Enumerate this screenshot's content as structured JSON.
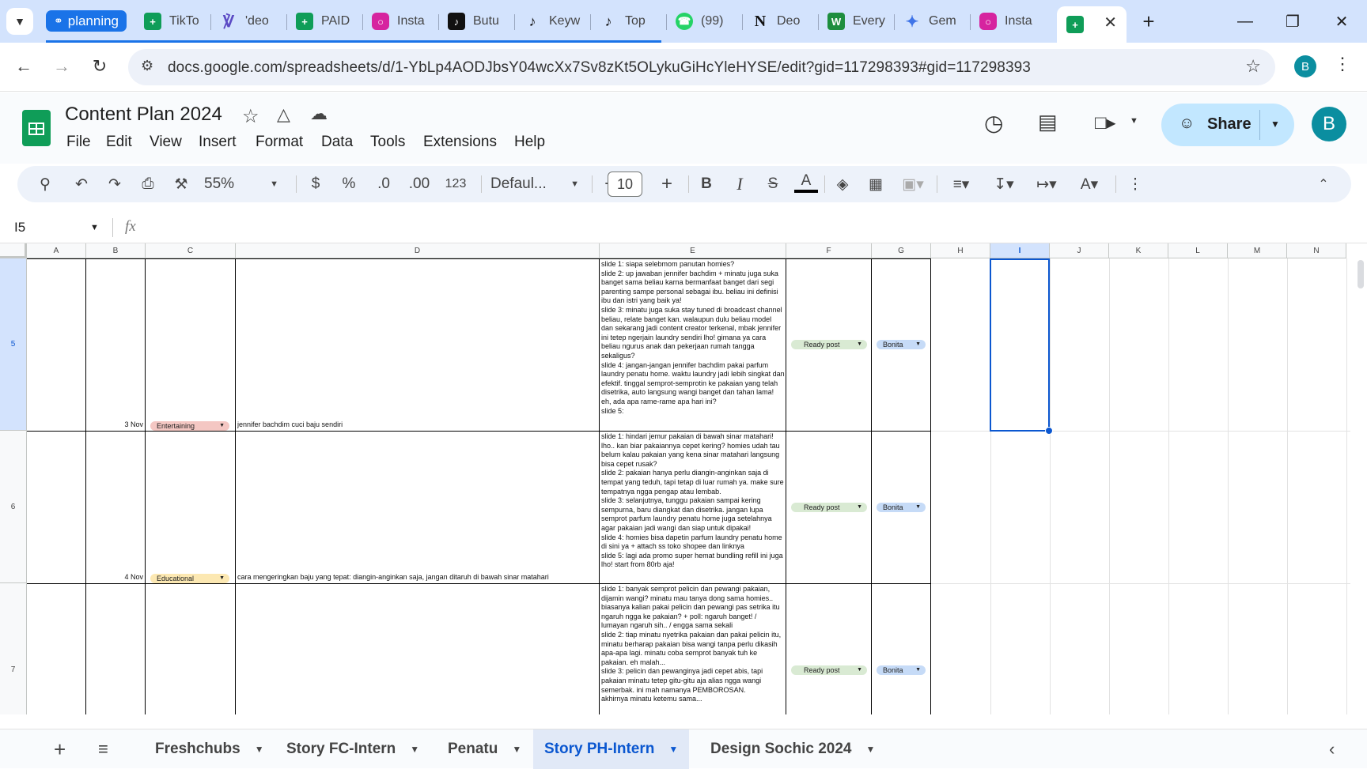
{
  "browser": {
    "profile_tab": "planning",
    "tabs": [
      {
        "label": "TikTo",
        "icon": "sheets-icon"
      },
      {
        "label": "'deo",
        "icon": "canva-icon"
      },
      {
        "label": "PAID",
        "icon": "sheets-icon"
      },
      {
        "label": "Insta",
        "icon": "instagram-icon"
      },
      {
        "label": "Butu",
        "icon": "tiktok-icon"
      },
      {
        "label": "Keyw",
        "icon": "tiktok-icon"
      },
      {
        "label": "Top",
        "icon": "tiktok-icon"
      },
      {
        "label": "(99)",
        "icon": "whatsapp-icon"
      },
      {
        "label": "Deo",
        "icon": "notion-icon"
      },
      {
        "label": "Every",
        "icon": "wix-icon"
      },
      {
        "label": "Gem",
        "icon": "gemini-icon"
      },
      {
        "label": "Insta",
        "icon": "instagram-icon"
      },
      {
        "label": "",
        "icon": "sheets-icon"
      }
    ],
    "url": "docs.google.com/spreadsheets/d/1-YbLp4AODJbsY04wcXx7Sv8zKt5OLykuGiHcYleHYSE/edit?gid=117298393#gid=117298393",
    "avatar_letter": "B"
  },
  "sheets": {
    "title": "Content Plan 2024",
    "menu": [
      "File",
      "Edit",
      "View",
      "Insert",
      "Format",
      "Data",
      "Tools",
      "Extensions",
      "Help"
    ],
    "share_label": "Share",
    "avatar_letter": "B",
    "toolbar": {
      "zoom": "55%",
      "currency": "$",
      "percent": "%",
      "dec_decrease": ".0",
      "dec_increase": ".00",
      "number_format": "123",
      "font": "Defaul...",
      "font_size": "10"
    },
    "name_box": "I5",
    "fx": "fx"
  },
  "grid": {
    "columns": [
      "A",
      "B",
      "C",
      "D",
      "E",
      "F",
      "G",
      "H",
      "I",
      "J",
      "K",
      "L",
      "M",
      "N"
    ],
    "rows": [
      {
        "num": "5",
        "date": "3 Nov",
        "category": "Entertaining",
        "category_color": "#f4c7c3",
        "title": "jennifer bachdim cuci baju sendiri",
        "script": "slide 1: siapa selebmom panutan homies?\nslide 2: up jawaban jennifer bachdim + minatu juga suka banget sama beliau karna bermanfaat banget dari segi parenting sampe personal sebagai ibu. beliau ini definisi ibu dan istri yang baik ya!\nslide 3: minatu juga suka stay tuned di broadcast channel beliau, relate banget kan. walaupun dulu beliau model dan sekarang jadi content creator terkenal, mbak jennifer ini tetep ngerjain laundry sendiri lho! gimana ya cara beliau ngurus anak dan pekerjaan rumah tangga sekaligus?\nslide 4: jangan-jangan jennifer bachdim pakai parfum laundry penatu home. waktu laundry jadi lebih singkat dan efektif. tinggal semprot-semprotin ke pakaian yang telah disetrika, auto langsung wangi banget dan tahan lama! eh, ada apa rame-rame apa hari ini?\nslide 5:",
        "status": "Ready post",
        "owner": "Bonita"
      },
      {
        "num": "6",
        "date": "4 Nov",
        "category": "Educational",
        "category_color": "#fce8b2",
        "title": "cara mengeringkan baju yang tepat: diangin-anginkan saja, jangan ditaruh di bawah sinar matahari",
        "script": "slide 1: hindari jemur pakaian di bawah sinar matahari! lho.. kan biar pakaiannya cepet kering? homies udah tau belum kalau pakaian yang kena sinar matahari langsung bisa cepet rusak?\nslide 2: pakaian hanya perlu diangin-anginkan saja di tempat yang teduh, tapi tetap di luar rumah ya. make sure tempatnya ngga pengap atau lembab.\nslide 3: selanjutnya, tunggu pakaian sampai kering sempurna, baru diangkat dan disetrika. jangan lupa semprot parfum laundry penatu home juga setelahnya agar pakaian jadi wangi dan siap untuk dipakai!\nslide 4: homies bisa dapetin parfum laundry penatu home di sini ya + attach ss toko shopee dan linknya\nslide 5: lagi ada promo super hemat bundling refill ini juga lho! start from 80rb aja!",
        "status": "Ready post",
        "owner": "Bonita"
      },
      {
        "num": "7",
        "date": "",
        "category": "",
        "category_color": "",
        "title": "",
        "script": "slide 1: banyak semprot pelicin dan pewangi pakaian, dijamin wangi? minatu mau tanya dong sama homies.. biasanya kalian pakai pelicin dan pewangi pas setrika itu ngaruh ngga ke pakaian? + poll: ngaruh banget! / lumayan ngaruh sih.. / engga sama sekali\nslide 2: tiap minatu nyetrika pakaian dan pakai pelicin itu, minatu berharap pakaian bisa wangi tanpa perlu dikasih apa-apa lagi. minatu coba semprot banyak tuh ke pakaian. eh malah...\nslide 3: pelicin dan pewanginya jadi cepet abis, tapi pakaian minatu tetep gitu-gitu aja alias ngga wangi semerbak. ini mah namanya PEMBOROSAN.\nakhirnya minatu ketemu sama...",
        "status": "Ready post",
        "owner": "Bonita"
      }
    ]
  },
  "sheet_tabs": [
    "Freshchubs",
    "Story FC-Intern",
    "Penatu",
    "Story PH-Intern",
    "Design Sochic 2024"
  ],
  "active_sheet_tab": "Story PH-Intern",
  "colors": {
    "accent": "#0b57d0",
    "status_chip": "#d9ead3",
    "owner_chip": "#c6dbf7",
    "tab_bar": "#d3e3fd"
  }
}
